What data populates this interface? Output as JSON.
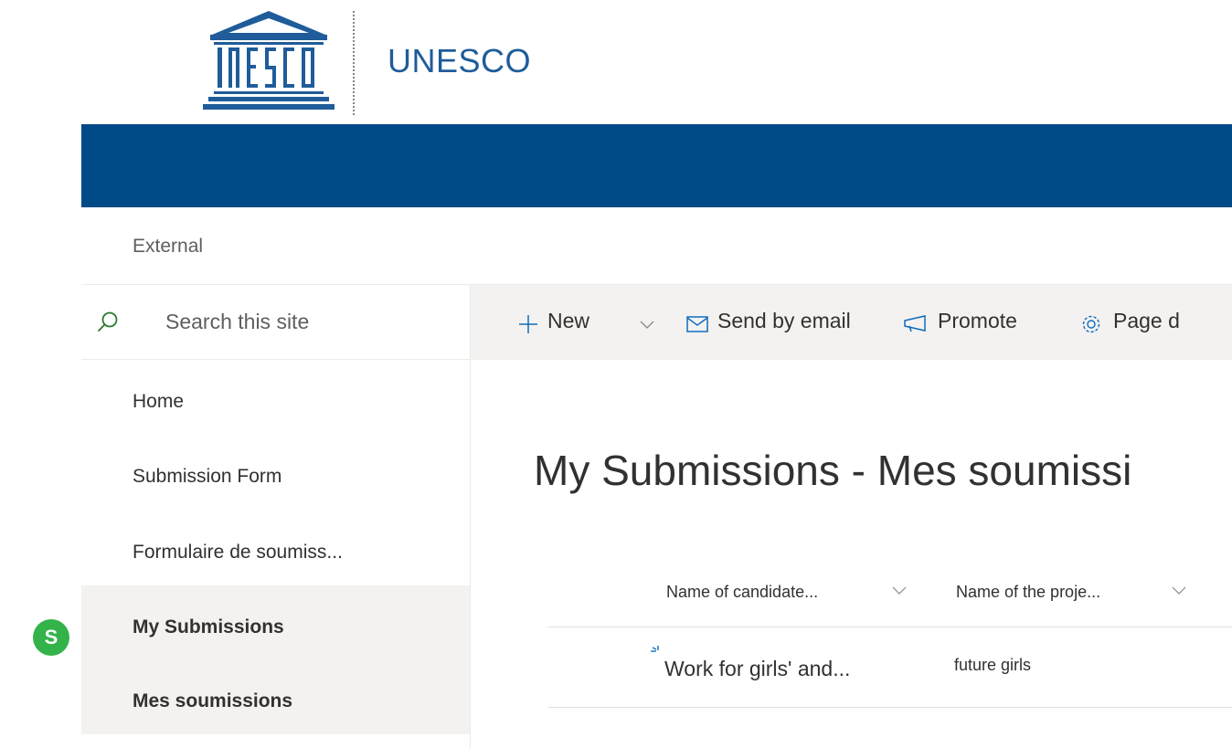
{
  "header": {
    "logo": {
      "icon": "unesco-temple-logo",
      "wordmark": "UNESCO"
    },
    "site_title": "UNESCO",
    "hub_color": "#004b87",
    "hub_label": "External"
  },
  "search": {
    "placeholder": "Search this site",
    "icon": "search-icon"
  },
  "nav": {
    "items": [
      {
        "label": "Home",
        "selected": false
      },
      {
        "label": "Submission Form",
        "selected": false
      },
      {
        "label": "Formulaire de soumiss...",
        "selected": false
      },
      {
        "label": "My Submissions",
        "selected": true
      },
      {
        "label": "Mes soumissions",
        "selected": true
      }
    ]
  },
  "command_bar": {
    "new_label": "New",
    "send_email_label": "Send by email",
    "promote_label": "Promote",
    "page_details_label": "Page d"
  },
  "page": {
    "title": "My Submissions -  Mes soumissi"
  },
  "list": {
    "columns": [
      "Name of candidate...",
      "Name of the proje..."
    ],
    "rows": [
      {
        "name": "Work for girls' and...",
        "project": "future girls"
      }
    ]
  },
  "badge": {
    "label": "S",
    "color": "#33b34a"
  },
  "colors": {
    "accent": "#004b87",
    "brand_text": "#1f5c99",
    "nav_selected": "#f3f2f1"
  }
}
